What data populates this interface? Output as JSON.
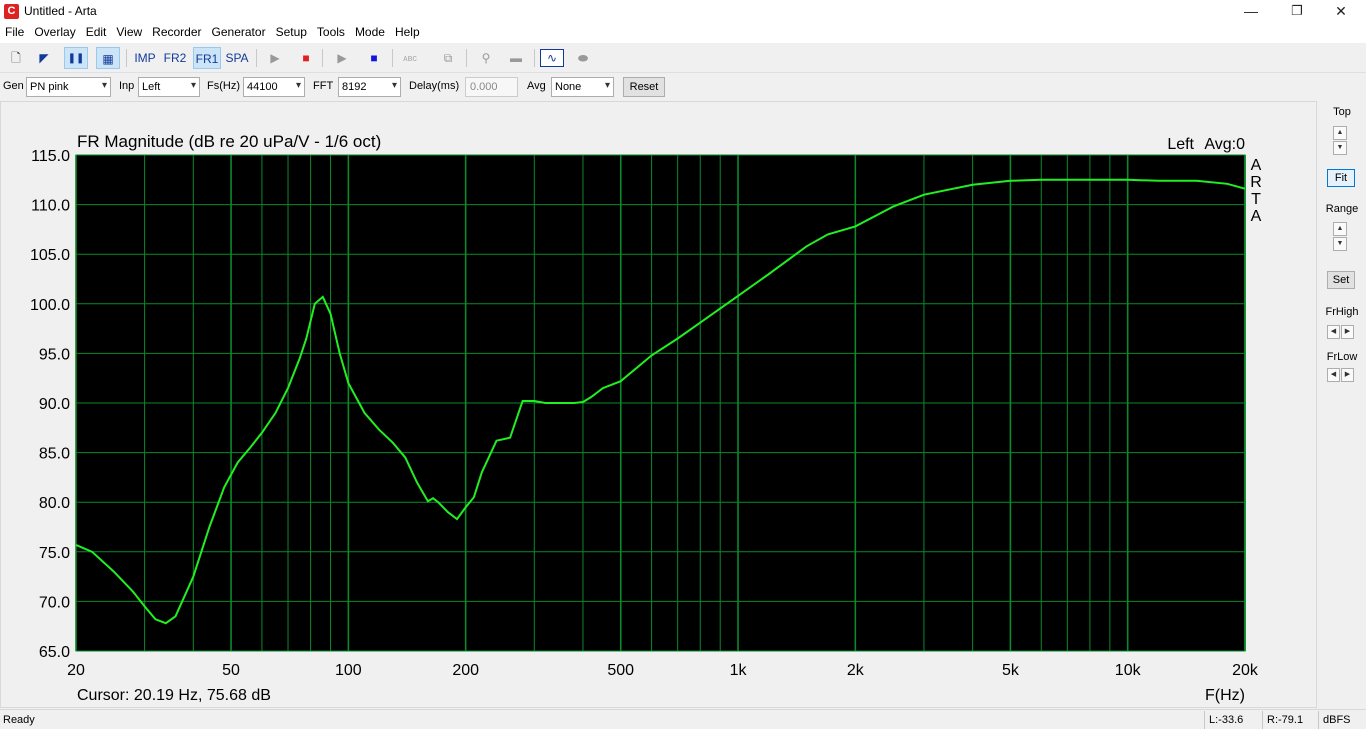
{
  "window": {
    "title": "Untitled - Arta",
    "app_icon": "arta-app-icon",
    "controls": {
      "minimize": "—",
      "maximize": "❐",
      "close": "✕"
    }
  },
  "menu": [
    "File",
    "Overlay",
    "Edit",
    "View",
    "Recorder",
    "Generator",
    "Setup",
    "Tools",
    "Mode",
    "Help"
  ],
  "toolbar": {
    "buttons": [
      {
        "name": "new-file-icon",
        "glyph": "🗋"
      },
      {
        "name": "mark-icon",
        "glyph": "◤"
      },
      {
        "name": "pause-icon",
        "glyph": "❚❚"
      },
      {
        "name": "table-icon",
        "glyph": "▦"
      },
      {
        "name": "imp",
        "label": "IMP"
      },
      {
        "name": "fr2",
        "label": "FR2"
      },
      {
        "name": "fr1",
        "label": "FR1"
      },
      {
        "name": "spa",
        "label": "SPA"
      },
      {
        "name": "play-icon",
        "glyph": "▶"
      },
      {
        "name": "stop-icon",
        "glyph": "■"
      },
      {
        "name": "play2-icon",
        "glyph": "▶"
      },
      {
        "name": "stop2-icon",
        "glyph": "■"
      },
      {
        "name": "abc-icon",
        "glyph": "ᴀʙᴄ"
      },
      {
        "name": "edit-icon",
        "glyph": "⧉"
      },
      {
        "name": "probe-icon",
        "glyph": "⚲"
      },
      {
        "name": "box-icon",
        "glyph": "▬"
      },
      {
        "name": "wave-icon",
        "glyph": "∿"
      },
      {
        "name": "pill-icon",
        "glyph": "⬬"
      }
    ]
  },
  "controls": {
    "gen_label": "Gen",
    "gen_value": "PN pink",
    "inp_label": "Inp",
    "inp_value": "Left",
    "fs_label": "Fs(Hz)",
    "fs_value": "44100",
    "fft_label": "FFT",
    "fft_value": "8192",
    "delay_label": "Delay(ms)",
    "delay_value": "0.000",
    "avg_label": "Avg",
    "avg_value": "None",
    "reset_label": "Reset"
  },
  "side": {
    "top_label": "Top",
    "fit_label": "Fit",
    "range_label": "Range",
    "set_label": "Set",
    "frhigh_label": "FrHigh",
    "frlow_label": "FrLow"
  },
  "status": {
    "ready": "Ready",
    "left_level": "L:-33.6",
    "right_level": "R:-79.1",
    "unit": "dBFS"
  },
  "colors": {
    "plot_bg": "#000000",
    "grid": "#0a8a2a",
    "curve": "#22ee22",
    "accent": "#123a9a"
  },
  "chart_data": {
    "type": "line",
    "title": "FR Magnitude (dB re 20 uPa/V - 1/6 oct)",
    "channel_label": "Left",
    "avg_label": "Avg:0",
    "watermark": "ARTA",
    "cursor_text": "Cursor: 20.19 Hz, 75.68 dB",
    "xlabel": "F(Hz)",
    "ylabel": "",
    "x_scale": "log",
    "xlim": [
      20,
      20000
    ],
    "ylim": [
      65,
      115
    ],
    "x_ticks": [
      20,
      50,
      100,
      200,
      500,
      1000,
      2000,
      5000,
      10000,
      20000
    ],
    "x_tick_labels": [
      "20",
      "50",
      "100",
      "200",
      "500",
      "1k",
      "2k",
      "5k",
      "10k",
      "20k"
    ],
    "y_ticks": [
      65,
      70,
      75,
      80,
      85,
      90,
      95,
      100,
      105,
      110,
      115
    ],
    "y_tick_labels": [
      "65.0",
      "70.0",
      "75.0",
      "80.0",
      "85.0",
      "90.0",
      "95.0",
      "100.0",
      "105.0",
      "110.0",
      "115.0"
    ],
    "grid": true,
    "series": [
      {
        "x": [
          20,
          22,
          25,
          28,
          30,
          32,
          34,
          36,
          40,
          44,
          48,
          52,
          56,
          60,
          65,
          70,
          75,
          78,
          82,
          86,
          90,
          95,
          100,
          110,
          120,
          130,
          140,
          150,
          160,
          165,
          170,
          180,
          190,
          200,
          210,
          220,
          240,
          260,
          280,
          300,
          320,
          350,
          380,
          400,
          420,
          450,
          500,
          600,
          700,
          800,
          1000,
          1200,
          1500,
          1700,
          2000,
          2500,
          3000,
          4000,
          5000,
          6000,
          8000,
          10000,
          12000,
          15000,
          18000,
          20000
        ],
        "y": [
          75.7,
          75.0,
          73.0,
          71.0,
          69.5,
          68.2,
          67.8,
          68.5,
          72.5,
          77.5,
          81.5,
          84.0,
          85.5,
          87.0,
          89.0,
          91.5,
          94.5,
          96.5,
          100.0,
          100.7,
          99.0,
          95.0,
          92.0,
          89.0,
          87.3,
          86.0,
          84.5,
          82.0,
          80.1,
          80.4,
          80.0,
          79.0,
          78.3,
          79.5,
          80.5,
          83.0,
          86.2,
          86.5,
          90.2,
          90.2,
          90.0,
          90.0,
          90.0,
          90.1,
          90.6,
          91.5,
          92.2,
          94.8,
          96.5,
          98.1,
          100.8,
          103.0,
          105.8,
          107.0,
          107.8,
          109.8,
          111.0,
          112.0,
          112.4,
          112.5,
          112.5,
          112.5,
          112.4,
          112.4,
          112.1,
          111.6
        ]
      }
    ]
  }
}
